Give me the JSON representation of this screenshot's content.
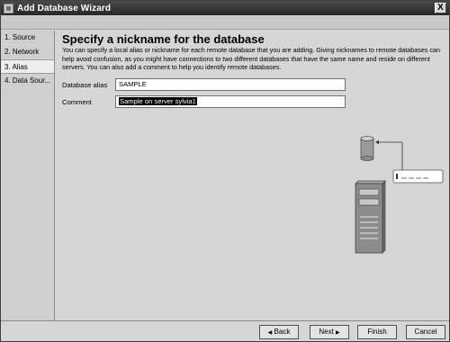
{
  "window": {
    "title": "Add Database Wizard",
    "close_label": "X"
  },
  "steps": [
    {
      "label": "1. Source",
      "active": false
    },
    {
      "label": "2. Network",
      "active": false
    },
    {
      "label": "3. Alias",
      "active": true
    },
    {
      "label": "4. Data Sour...",
      "active": false
    }
  ],
  "page": {
    "heading": "Specify a nickname for the database",
    "description": "You can specify a local alias or nickname for each remote database that you are adding. Giving nicknames to remote databases can help avoid confusion, as you might have connections to two different databases that have the same name and reside on different servers. You can also add a comment to help you identify remote databases."
  },
  "form": {
    "alias_label": "Database alias",
    "alias_value": "SAMPLE",
    "comment_label": "Comment",
    "comment_value": "Sample on server sylvia1"
  },
  "buttons": {
    "back": "Back",
    "next": "Next",
    "finish": "Finish",
    "cancel": "Cancel"
  },
  "icons": {
    "back": "triangle-left-icon",
    "next": "triangle-right-icon",
    "illustration": [
      "database-cylinder-icon",
      "server-tower-icon",
      "label-tag-icon"
    ]
  }
}
